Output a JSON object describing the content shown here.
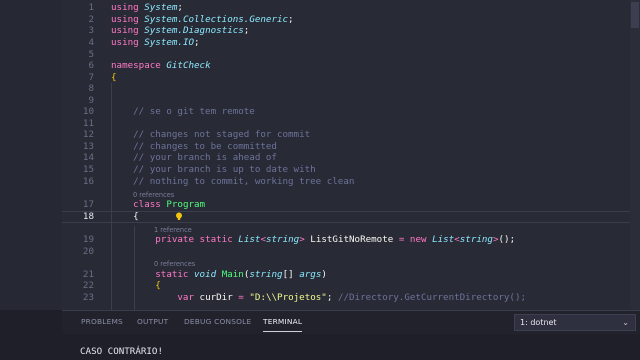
{
  "editor": {
    "lines": [
      {
        "n": "1",
        "html": "<span class=\"k\">using</span> <span class=\"t\">System</span><span class=\"p\">;</span>"
      },
      {
        "n": "2",
        "html": "<span class=\"k\">using</span> <span class=\"t\">System.Collections.Generic</span><span class=\"p\">;</span>"
      },
      {
        "n": "3",
        "html": "<span class=\"k\">using</span> <span class=\"t\">System.Diagnostics</span><span class=\"p\">;</span>"
      },
      {
        "n": "4",
        "html": "<span class=\"k\">using</span> <span class=\"t\">System.IO</span><span class=\"p\">;</span>"
      },
      {
        "n": "5",
        "html": ""
      },
      {
        "n": "6",
        "html": "<span class=\"k\">namespace</span> <span class=\"t\">GitCheck</span>"
      },
      {
        "n": "7",
        "html": "<span class=\"y\">{</span>"
      },
      {
        "n": "8",
        "html": ""
      },
      {
        "n": "9",
        "html": ""
      },
      {
        "n": "10",
        "html": "    <span class=\"c\">// se o git tem remote</span>"
      },
      {
        "n": "11",
        "html": ""
      },
      {
        "n": "12",
        "html": "    <span class=\"c\">// changes not staged for commit</span>"
      },
      {
        "n": "13",
        "html": "    <span class=\"c\">// changes to be committed</span>"
      },
      {
        "n": "14",
        "html": "    <span class=\"c\">// your branch is ahead of</span>"
      },
      {
        "n": "15",
        "html": "    <span class=\"c\">// your branch is up to date with</span>"
      },
      {
        "n": "16",
        "html": "    <span class=\"c\">// nothing to commit, working tree clean</span>"
      },
      {
        "n": "17",
        "html": "    <span class=\"k\">class</span> <span class=\"f\">Program</span>"
      },
      {
        "n": "18",
        "html": "    <span class=\"p\">{</span>"
      },
      {
        "n": "19",
        "html": "        <span class=\"k\">private</span> <span class=\"k\">static</span> <span class=\"g\">List</span><span class=\"k\">&lt;</span><span class=\"g\">string</span><span class=\"k\">&gt;</span> <span class=\"p\">ListGitNoRemote</span> <span class=\"k\">=</span> <span class=\"k\">new</span> <span class=\"g\">List</span><span class=\"k\">&lt;</span><span class=\"g\">string</span><span class=\"k\">&gt;</span><span class=\"p\">();</span>"
      },
      {
        "n": "20",
        "html": ""
      },
      {
        "n": "21",
        "html": "        <span class=\"k\">static</span> <span class=\"g\">void</span> <span class=\"f\">Main</span><span class=\"p\">(</span><span class=\"g\">string</span><span class=\"p\">[]</span> <span class=\"t\">args</span><span class=\"p\">)</span>"
      },
      {
        "n": "22",
        "html": "        <span class=\"y\">{</span>"
      },
      {
        "n": "23",
        "html": "            <span class=\"k\">var</span> <span class=\"p\">curDir</span> <span class=\"k\">=</span> <span class=\"s\">\"D:\\\\Projetos\"</span><span class=\"p\">;</span> <span class=\"c\">//Directory.GetCurrentDirectory();</span>"
      }
    ],
    "codelens": [
      "0 references",
      "1 reference",
      "0 references"
    ]
  },
  "panel": {
    "tabs": [
      "PROBLEMS",
      "OUTPUT",
      "DEBUG CONSOLE",
      "TERMINAL"
    ],
    "terminal_select": "1: dotnet"
  },
  "terminal": {
    "line1": "CASO CONTRÁRIO!"
  }
}
